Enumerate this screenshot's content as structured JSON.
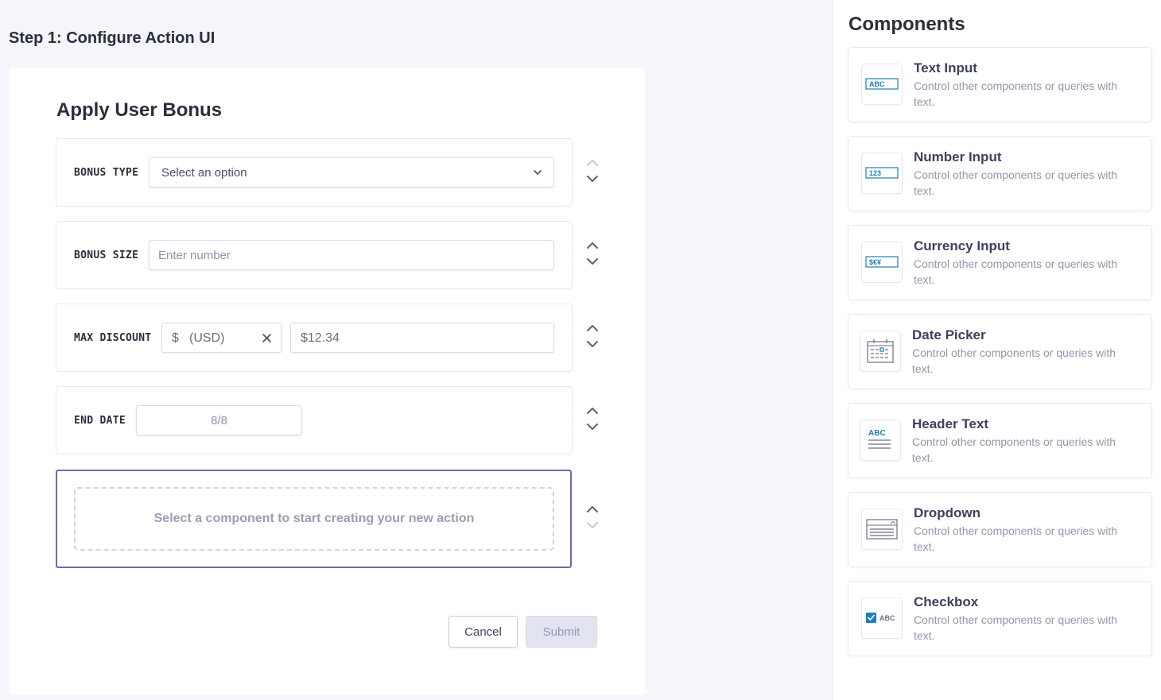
{
  "main": {
    "step_title": "Step 1: Configure Action UI",
    "form_title": "Apply User Bonus",
    "rows": [
      {
        "label": "BONUS TYPE",
        "placeholder": "Select an option"
      },
      {
        "label": "BONUS SIZE",
        "placeholder": "Enter number"
      },
      {
        "label": "MAX DISCOUNT",
        "currency_symbol": "$",
        "currency_code": "(USD)",
        "amount": "$12.34"
      },
      {
        "label": "END DATE",
        "value": "8/8"
      }
    ],
    "drop_zone_text": "Select a component to start creating your new action",
    "cancel_label": "Cancel",
    "submit_label": "Submit"
  },
  "sidebar": {
    "title": "Components",
    "items": [
      {
        "name": "Text Input",
        "desc": "Control other components or queries with text.",
        "icon": "text-input-icon",
        "glyph": "ABC"
      },
      {
        "name": "Number Input",
        "desc": "Control other components or queries with text.",
        "icon": "number-input-icon",
        "glyph": "123"
      },
      {
        "name": "Currency Input",
        "desc": "Control other components or queries with text.",
        "icon": "currency-input-icon",
        "glyph": "$€¥"
      },
      {
        "name": "Date Picker",
        "desc": "Control other components or queries with text.",
        "icon": "calendar-icon"
      },
      {
        "name": "Header Text",
        "desc": "Control other components or queries with text.",
        "icon": "header-text-icon",
        "glyph": "ABC"
      },
      {
        "name": "Dropdown",
        "desc": "Control other components or queries with text.",
        "icon": "dropdown-icon"
      },
      {
        "name": "Checkbox",
        "desc": "Control other components or queries with text.",
        "icon": "checkbox-icon",
        "glyph": "ABC"
      }
    ]
  },
  "colors": {
    "accent": "#6b6cae",
    "icon_blue": "#1a7fb5",
    "background": "#f5f6fc"
  }
}
